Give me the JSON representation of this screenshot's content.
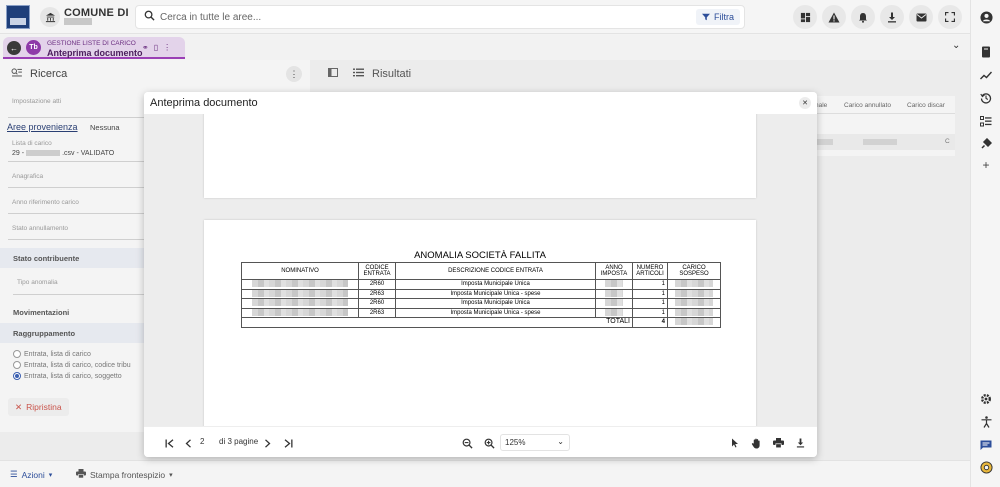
{
  "topbar": {
    "comune_label": "COMUNE DI",
    "search_placeholder": "Cerca in tutte le aree...",
    "filter_label": "Filtra",
    "icons": [
      "dashboard-icon",
      "warning-icon",
      "bell-icon",
      "download-icon",
      "mail-icon",
      "fullscreen-icon"
    ]
  },
  "rail_icons": [
    "account-icon",
    "book-icon",
    "trend-icon",
    "history-icon",
    "checklist-icon",
    "plugin-icon",
    "add-icon",
    "settings-icon",
    "accessibility-icon",
    "chat-icon",
    "support-icon"
  ],
  "tab": {
    "badge": "Tb",
    "subtitle": "GESTIONE LISTE DI CARICO",
    "title": "Anteprima documento"
  },
  "search_panel": {
    "title": "Ricerca",
    "fields": {
      "impostazione_atti": "Impostazione atti",
      "aree_provenienza": "Aree provenienza",
      "aree_value": "Nessuna",
      "lista_di_carico": "Lista di carico",
      "lista_prefix": "29 -",
      "lista_suffix": ".csv - VALIDATO",
      "anagrafica": "Anagrafica",
      "anno_riferimento": "Anno riferimento carico",
      "stato_annullamento": "Stato annullamento",
      "stato_contribuente": "Stato contribuente",
      "tipo_anomalia": "Tipo anomalia",
      "movimentazioni": "Movimentazioni",
      "raggruppamento": "Raggruppamento"
    },
    "radio_options": [
      {
        "label": "Entrata, lista di carico",
        "selected": false
      },
      {
        "label": "Entrata, lista di carico, codice tribu",
        "selected": false
      },
      {
        "label": "Entrata, lista di carico, soggetto",
        "selected": true
      }
    ],
    "reset_label": "Ripristina"
  },
  "results_panel": {
    "title": "Risultati",
    "columns": [
      "nale",
      "Carico annullato",
      "Carico discar"
    ],
    "row_tail": "C"
  },
  "footer": {
    "actions_label": "Azioni",
    "print_label": "Stampa frontespizio"
  },
  "modal": {
    "title": "Anteprima documento",
    "report": {
      "title": "ANOMALIA SOCIETÀ FALLITA",
      "headers": [
        "NOMINATIVO",
        "CODICE ENTRATA",
        "DESCRIZIONE CODICE ENTRATA",
        "ANNO IMPOSTA",
        "NUMERO ARTICOLI",
        "CARICO SOSPESO"
      ],
      "rows": [
        {
          "codice": "2R60",
          "descrizione": "Imposta Municipale Unica",
          "articoli": "1"
        },
        {
          "codice": "2R63",
          "descrizione": "Imposta Municipale Unica - spese",
          "articoli": "1"
        },
        {
          "codice": "2R60",
          "descrizione": "Imposta Municipale Unica",
          "articoli": "1"
        },
        {
          "codice": "2R63",
          "descrizione": "Imposta Municipale Unica - spese",
          "articoli": "1"
        }
      ],
      "totals_label": "TOTALI",
      "totals_articoli": "4"
    },
    "toolbar": {
      "current_page": "2",
      "page_of": "di 3 pagine",
      "zoom": "125%"
    }
  }
}
